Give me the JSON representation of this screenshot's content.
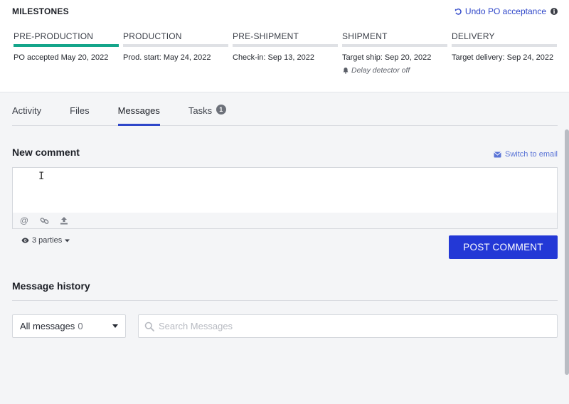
{
  "milestones": {
    "title": "MILESTONES",
    "undo_label": "Undo PO acceptance",
    "stages": [
      {
        "name": "PRE-PRODUCTION",
        "date": "PO accepted May 20, 2022",
        "active": true
      },
      {
        "name": "PRODUCTION",
        "date": "Prod. start: May 24, 2022",
        "active": false
      },
      {
        "name": "PRE-SHIPMENT",
        "date": "Check-in: Sep 13, 2022",
        "active": false
      },
      {
        "name": "SHIPMENT",
        "date": "Target ship: Sep 20, 2022",
        "note": "Delay detector off",
        "active": false
      },
      {
        "name": "DELIVERY",
        "date": "Target delivery: Sep 24, 2022",
        "active": false
      }
    ]
  },
  "tabs": [
    {
      "label": "Activity",
      "active": false
    },
    {
      "label": "Files",
      "active": false
    },
    {
      "label": "Messages",
      "active": true
    },
    {
      "label": "Tasks",
      "badge": "1",
      "active": false
    }
  ],
  "comment": {
    "heading": "New comment",
    "switch_label": "Switch to email",
    "value": "",
    "tools": [
      "at-sign-icon",
      "link-icon",
      "upload-icon"
    ],
    "parties_label": "3 parties",
    "post_label": "POST COMMENT"
  },
  "history": {
    "heading": "Message history",
    "filter_label": "All messages",
    "filter_count": "0",
    "search_placeholder": "Search Messages"
  },
  "colors": {
    "accent": "#2338d6",
    "progress": "#14a58a",
    "link": "#2e46c9"
  }
}
